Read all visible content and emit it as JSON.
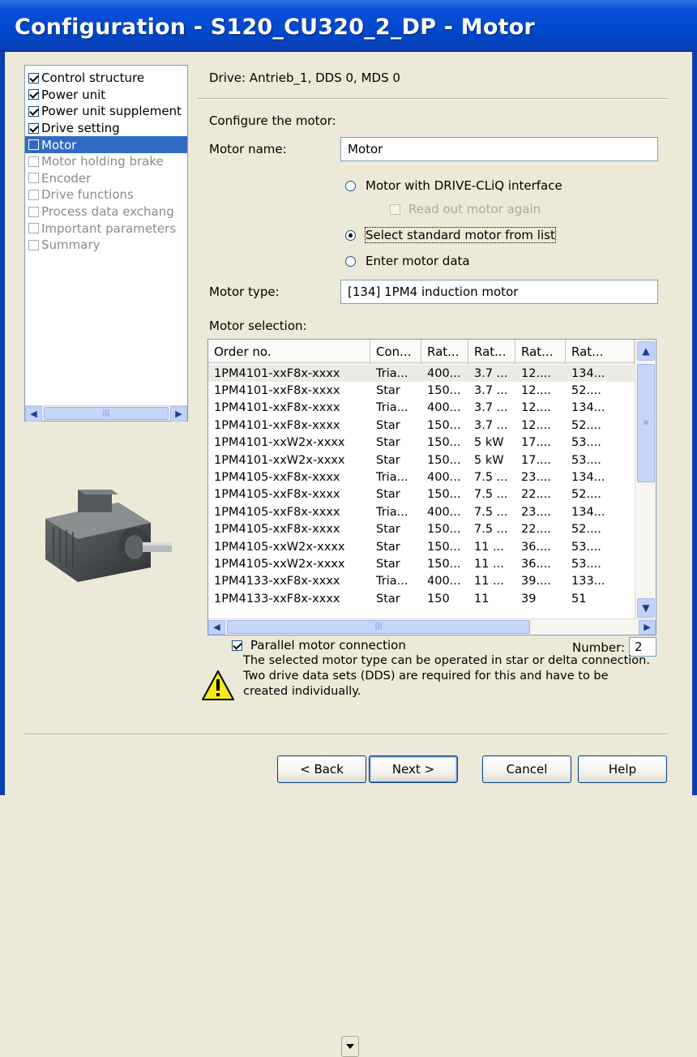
{
  "window": {
    "title": "Configuration - S120_CU320_2_DP - Motor"
  },
  "nav": {
    "items": [
      {
        "label": "Control structure",
        "checked": true,
        "state": "done"
      },
      {
        "label": "Power unit",
        "checked": true,
        "state": "done"
      },
      {
        "label": "Power unit supplement",
        "checked": true,
        "state": "done"
      },
      {
        "label": "Drive setting",
        "checked": true,
        "state": "done"
      },
      {
        "label": "Motor",
        "checked": false,
        "state": "selected"
      },
      {
        "label": "Motor holding brake",
        "checked": false,
        "state": "pending"
      },
      {
        "label": "Encoder",
        "checked": false,
        "state": "pending"
      },
      {
        "label": "Drive functions",
        "checked": false,
        "state": "pending"
      },
      {
        "label": "Process data exchang",
        "checked": false,
        "state": "pending"
      },
      {
        "label": "Important parameters",
        "checked": false,
        "state": "pending"
      },
      {
        "label": "Summary",
        "checked": false,
        "state": "pending"
      }
    ]
  },
  "drive_info": "Drive: Antrieb_1, DDS 0, MDS 0",
  "form": {
    "configure_label": "Configure the motor:",
    "motor_name_label": "Motor name:",
    "motor_name_value": "Motor",
    "radio_drive_cliq": "Motor with DRIVE-CLiQ interface",
    "readout_again": "Read out motor again",
    "radio_standard": "Select standard motor from list",
    "radio_enter": "Enter motor data",
    "motor_type_label": "Motor type:",
    "motor_type_value": "[134] 1PM4 induction motor",
    "motor_selection_label": "Motor selection:"
  },
  "motor_list": {
    "columns": [
      "Order no.",
      "Con...",
      "Rat...",
      "Rat...",
      "Rat...",
      "Rat..."
    ],
    "rows": [
      [
        "1PM4101-xxF8x-xxxx",
        "Tria...",
        "400...",
        "3.7 ...",
        "12....",
        "134..."
      ],
      [
        "1PM4101-xxF8x-xxxx",
        "Star",
        "150...",
        "3.7 ...",
        "12....",
        "52...."
      ],
      [
        "1PM4101-xxF8x-xxxx",
        "Tria...",
        "400...",
        "3.7 ...",
        "12....",
        "134..."
      ],
      [
        "1PM4101-xxF8x-xxxx",
        "Star",
        "150...",
        "3.7 ...",
        "12....",
        "52...."
      ],
      [
        "1PM4101-xxW2x-xxxx",
        "Star",
        "150...",
        "5 kW",
        "17....",
        "53...."
      ],
      [
        "1PM4101-xxW2x-xxxx",
        "Star",
        "150...",
        "5 kW",
        "17....",
        "53...."
      ],
      [
        "1PM4105-xxF8x-xxxx",
        "Tria...",
        "400...",
        "7.5 ...",
        "23....",
        "134..."
      ],
      [
        "1PM4105-xxF8x-xxxx",
        "Star",
        "150...",
        "7.5 ...",
        "22....",
        "52...."
      ],
      [
        "1PM4105-xxF8x-xxxx",
        "Tria...",
        "400...",
        "7.5 ...",
        "23....",
        "134..."
      ],
      [
        "1PM4105-xxF8x-xxxx",
        "Star",
        "150...",
        "7.5 ...",
        "22....",
        "52...."
      ],
      [
        "1PM4105-xxW2x-xxxx",
        "Star",
        "150...",
        "11 ...",
        "36....",
        "53...."
      ],
      [
        "1PM4105-xxW2x-xxxx",
        "Star",
        "150...",
        "11 ...",
        "36....",
        "53...."
      ],
      [
        "1PM4133-xxF8x-xxxx",
        "Tria...",
        "400...",
        "11 ...",
        "39....",
        "133..."
      ],
      [
        "1PM4133-xxF8x-xxxx",
        "Star",
        "150",
        "11",
        "39",
        "51"
      ]
    ]
  },
  "parallel": {
    "label": "Parallel motor connection",
    "number_label": "Number:",
    "number_value": "2",
    "checked": true
  },
  "warning_text": "The selected motor type can be operated in star or delta connection. Two drive data sets (DDS) are required for this and have to be created individually.",
  "buttons": {
    "back": "< Back",
    "next": "Next >",
    "cancel": "Cancel",
    "help": "Help"
  },
  "colors": {
    "titlebar": "#0046c8",
    "selection": "#316ac5",
    "face": "#ece9d8"
  },
  "icons": [
    "checkbox",
    "radio",
    "chevron-left-icon",
    "chevron-right-icon",
    "chevron-up-icon",
    "chevron-down-icon",
    "warning-icon",
    "motor-image"
  ]
}
